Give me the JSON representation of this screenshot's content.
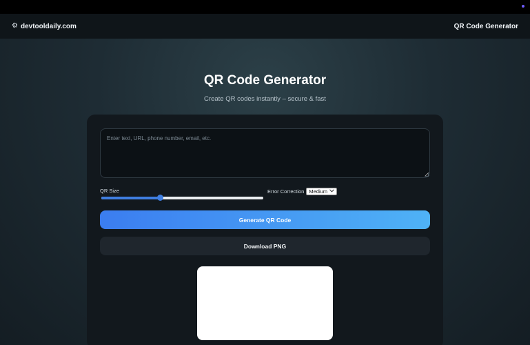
{
  "navbar": {
    "brand_icon": "⚙",
    "brand": "devtooldaily.com",
    "link": "QR Code Generator"
  },
  "hero": {
    "title": "QR Code Generator",
    "subtitle": "Create QR codes instantly – secure & fast"
  },
  "form": {
    "input": {
      "value": "",
      "placeholder": "Enter text, URL, phone number, email, etc."
    },
    "size_label": "QR Size",
    "size_level": 0.36,
    "error_correction_label": "Error Correction",
    "error_correction_value": "Medium",
    "generate_label": "Generate QR Code",
    "download_label": "Download PNG"
  },
  "colors": {
    "accent": "#3f7ee0",
    "gradient_start": "#3b7df0",
    "gradient_end": "#4fb2f6"
  },
  "icons": {
    "brand": "gear-icon",
    "select": "chevron-down-icon"
  }
}
